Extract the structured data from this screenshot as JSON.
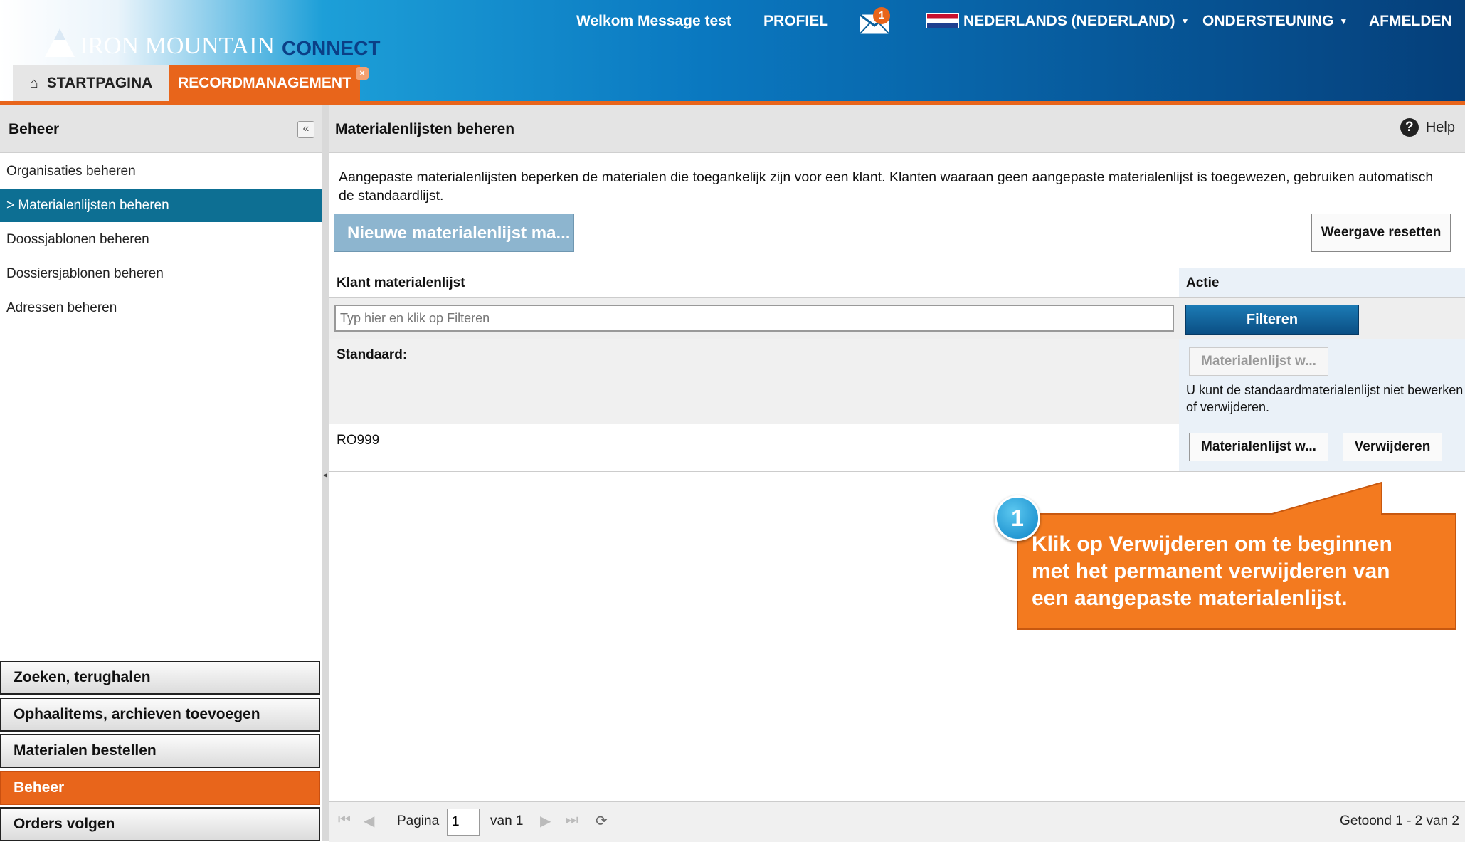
{
  "header": {
    "logo_text": "IRON MOUNTAIN",
    "logo_sub": "CONNECT",
    "welcome": "Welkom Message test",
    "profile": "PROFIEL",
    "mail_count": "1",
    "language": "NEDERLANDS (NEDERLAND)",
    "support": "ONDERSTEUNING",
    "logout": "AFMELDEN"
  },
  "tabs": [
    {
      "label": "STARTPAGINA"
    },
    {
      "label": "RECORDMANAGEMENT"
    }
  ],
  "sidebar": {
    "title": "Beheer",
    "items": [
      {
        "label": "Organisaties beheren"
      },
      {
        "label": "> Materialenlijsten beheren"
      },
      {
        "label": "Doossjablonen beheren"
      },
      {
        "label": "Dossiersjablonen beheren"
      },
      {
        "label": "Adressen beheren"
      }
    ],
    "sections": [
      {
        "label": "Zoeken, terughalen"
      },
      {
        "label": "Ophaalitems, archieven toevoegen"
      },
      {
        "label": "Materialen bestellen"
      },
      {
        "label": "Beheer"
      },
      {
        "label": "Orders volgen"
      }
    ]
  },
  "main": {
    "title": "Materialenlijsten beheren",
    "help": "Help",
    "intro": "Aangepaste materialenlijsten beperken de materialen die toegankelijk zijn voor een klant. Klanten waaraan geen aangepaste materialenlijst is toegewezen, gebruiken automatisch de standaardlijst.",
    "new_button": "Nieuwe materialenlijst ma...",
    "reset_button": "Weergave resetten",
    "columns": {
      "name": "Klant materialenlijst",
      "action": "Actie"
    },
    "filter_placeholder": "Typ hier en klik op Filteren",
    "filter_button": "Filteren",
    "rows": [
      {
        "name": "Standaard:",
        "edit_button": "Materialenlijst w...",
        "note": "U kunt de standaardmaterialenlijst niet bewerken of verwijderen."
      },
      {
        "name": "RO999",
        "edit_button": "Materialenlijst w...",
        "delete_button": "Verwijderen"
      }
    ],
    "pager": {
      "page_label": "Pagina",
      "page_value": "1",
      "of_label": "van 1",
      "summary": "Getoond 1 - 2 van 2"
    }
  },
  "callout": {
    "step": "1",
    "text": "Klik op Verwijderen om te beginnen met het permanent verwijderen van een aangepaste materialenlijst."
  },
  "colors": {
    "accent_orange": "#e8651b",
    "active_teal": "#0d6f93",
    "header_blue": "#0a78c0"
  }
}
